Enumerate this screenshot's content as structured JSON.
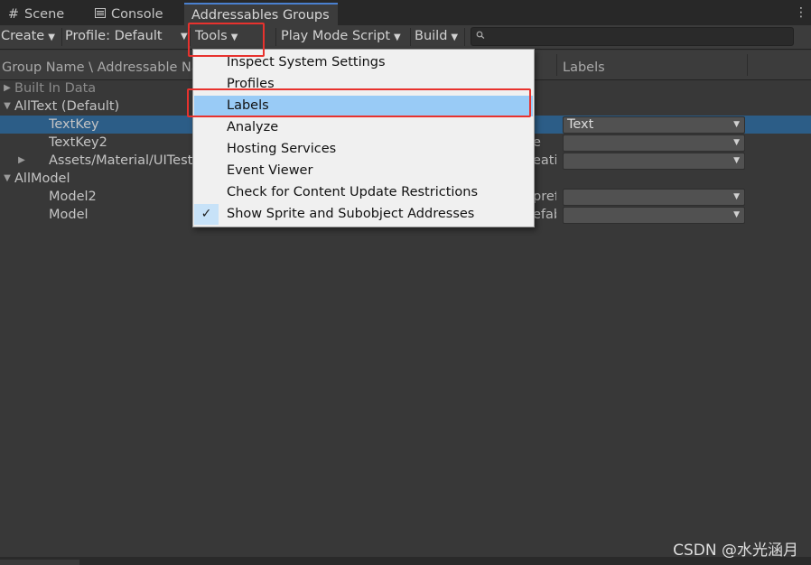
{
  "tabs": [
    {
      "label": "Scene",
      "icon": "grid-icon"
    },
    {
      "label": "Console",
      "icon": "console-icon"
    },
    {
      "label": "Addressables Groups",
      "icon": ""
    }
  ],
  "toolbar": {
    "create": "Create",
    "profile": "Profile: Default",
    "tools": "Tools",
    "play_mode": "Play Mode Script",
    "build": "Build",
    "search_value": ""
  },
  "header": {
    "group_name": "Group Name \\ Addressable Name",
    "labels": "Labels"
  },
  "rows": [
    {
      "name": "Built In Data"
    },
    {
      "name": "AllText (Default)"
    },
    {
      "name": "TextKey",
      "label_value": "Text"
    },
    {
      "name": "TextKey2",
      "path_frag": "e"
    },
    {
      "name": "Assets/Material/UITest",
      "path_frag": "eatia"
    },
    {
      "name": "AllModel"
    },
    {
      "name": "Model2",
      "path_frag": "pref"
    },
    {
      "name": "Model",
      "path_frag": "efab"
    }
  ],
  "menu": {
    "items": [
      {
        "label": "Inspect System Settings"
      },
      {
        "label": "Profiles"
      },
      {
        "label": "Labels"
      },
      {
        "label": "Analyze"
      },
      {
        "label": "Hosting Services"
      },
      {
        "label": "Event Viewer"
      },
      {
        "label": "Check for Content Update Restrictions"
      },
      {
        "label": "Show Sprite and Subobject Addresses"
      }
    ],
    "highlighted": "Labels",
    "checked": "Show Sprite and Subobject Addresses"
  },
  "watermark": "CSDN @水光涵月",
  "colors": {
    "selection": "#2c5d87",
    "menu_highlight": "#99cbf6",
    "annotation": "#e8322e",
    "tab_accent": "#4a80cf"
  }
}
